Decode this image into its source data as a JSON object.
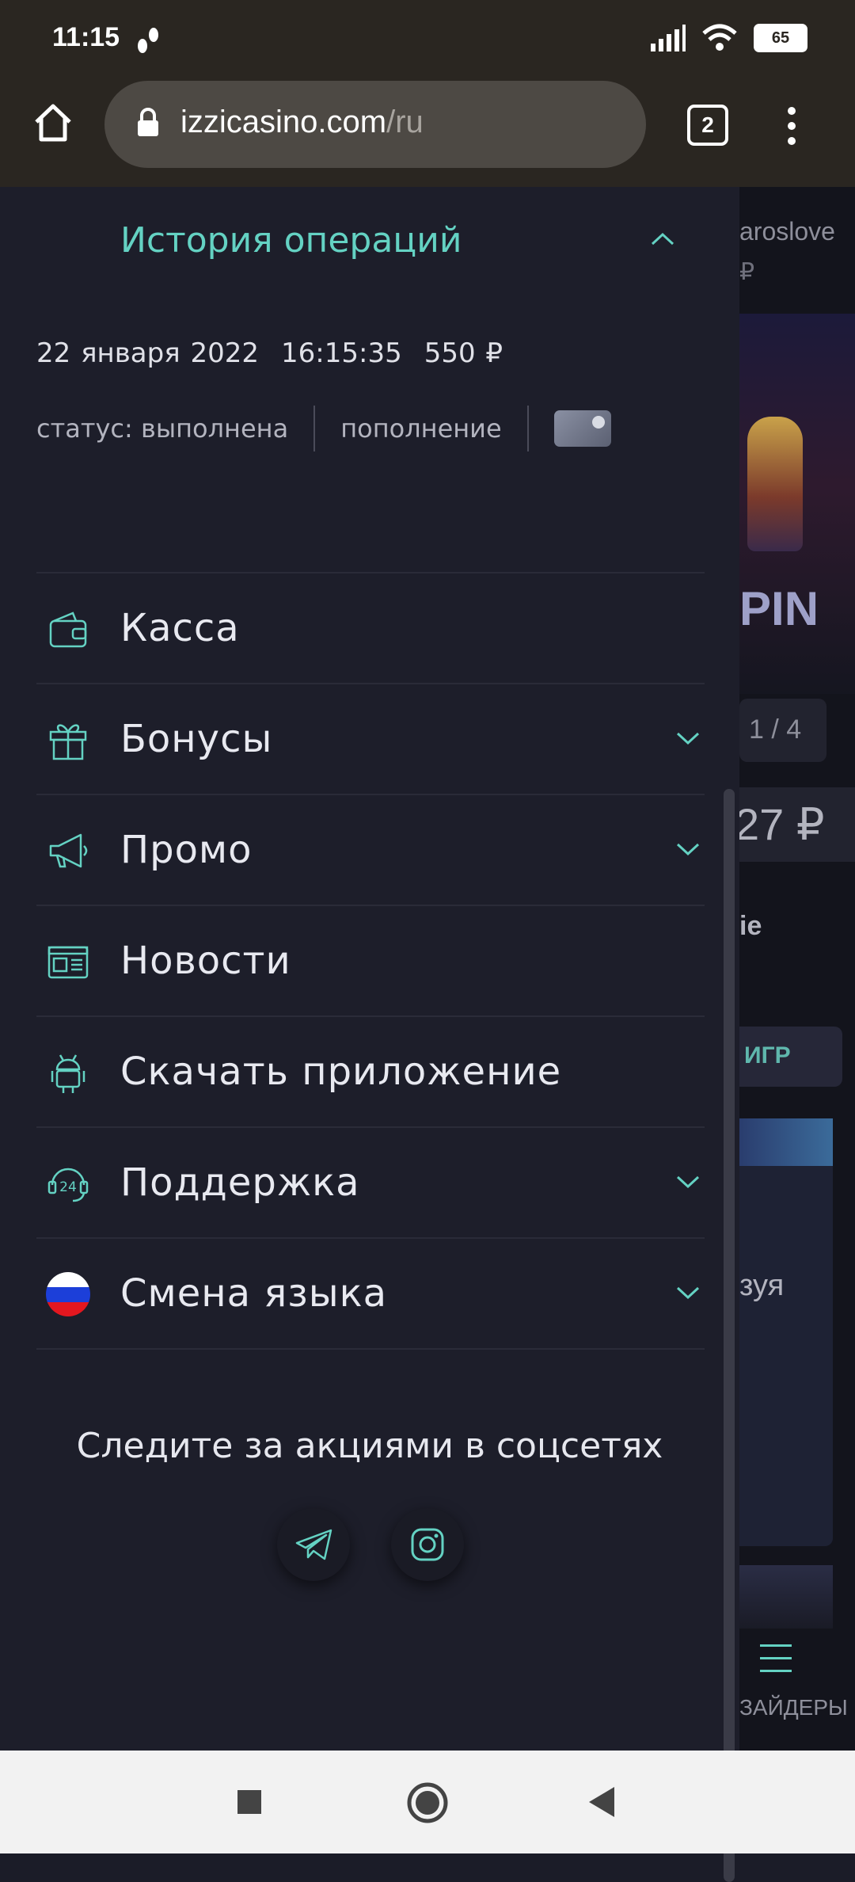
{
  "status_bar": {
    "time": "11:15",
    "battery": "65"
  },
  "browser": {
    "url_domain": "izzicasino.com",
    "url_path": "/ru",
    "tab_count": "2"
  },
  "backdrop": {
    "user": "aroslove",
    "currency": "₽",
    "slide_counter": "1 / 4",
    "balance": "27 ₽",
    "partial_1": "ie",
    "button_games": "ИГР",
    "partial_2": "зуя",
    "nav_label": "ЗАЙДЕРЫ",
    "banner_text": "PIN"
  },
  "history": {
    "title": "История операций",
    "date": "22 января 2022",
    "time": "16:15:35",
    "amount": "550 ₽",
    "status": "статус: выполнена",
    "type": "пополнение"
  },
  "menu": {
    "items": [
      {
        "label": "Касса",
        "icon": "wallet-icon",
        "has_chevron": false
      },
      {
        "label": "Бонусы",
        "icon": "gift-icon",
        "has_chevron": true
      },
      {
        "label": "Промо",
        "icon": "megaphone-icon",
        "has_chevron": true
      },
      {
        "label": "Новости",
        "icon": "newspaper-icon",
        "has_chevron": false
      },
      {
        "label": "Скачать приложение",
        "icon": "android-icon",
        "has_chevron": false
      },
      {
        "label": "Поддержка",
        "icon": "support-24-icon",
        "has_chevron": true
      },
      {
        "label": "Смена языка",
        "icon": "russia-flag-icon",
        "has_chevron": true
      }
    ]
  },
  "social": {
    "title": "Следите за акциями в соцсетях"
  },
  "colors": {
    "accent": "#64d2c3",
    "drawer_bg": "#1d1e2a",
    "chrome_bg": "#2a2621"
  }
}
